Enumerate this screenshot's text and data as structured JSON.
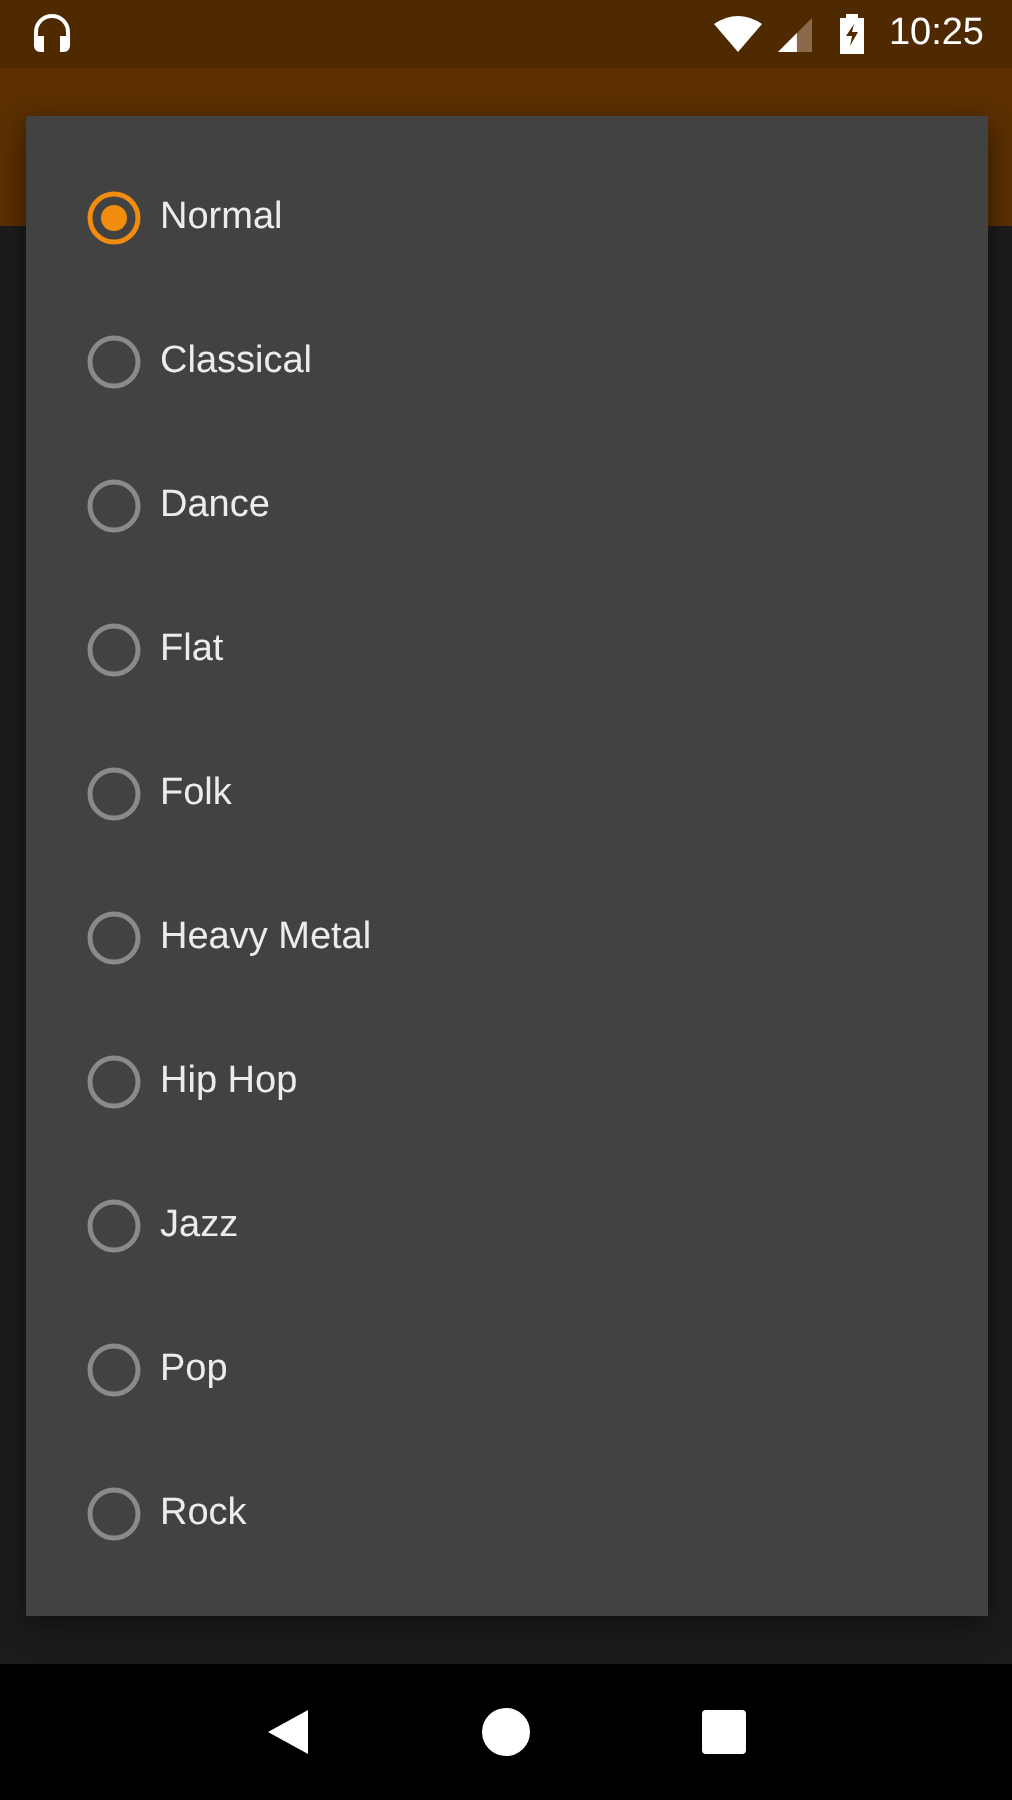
{
  "status_bar": {
    "time": "10:25"
  },
  "presets": [
    {
      "label": "Normal",
      "selected": true
    },
    {
      "label": "Classical",
      "selected": false
    },
    {
      "label": "Dance",
      "selected": false
    },
    {
      "label": "Flat",
      "selected": false
    },
    {
      "label": "Folk",
      "selected": false
    },
    {
      "label": "Heavy Metal",
      "selected": false
    },
    {
      "label": "Hip Hop",
      "selected": false
    },
    {
      "label": "Jazz",
      "selected": false
    },
    {
      "label": "Pop",
      "selected": false
    },
    {
      "label": "Rock",
      "selected": false
    }
  ]
}
